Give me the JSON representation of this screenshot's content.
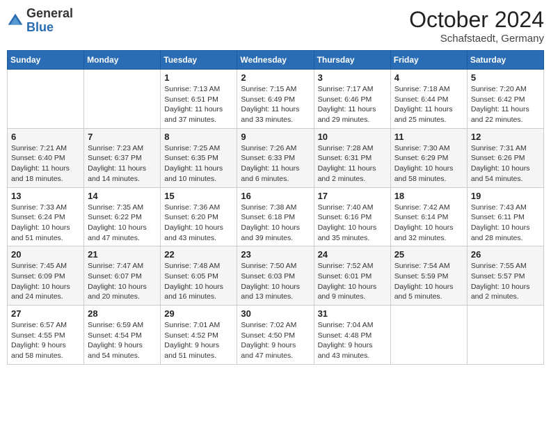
{
  "header": {
    "logo_general": "General",
    "logo_blue": "Blue",
    "month_title": "October 2024",
    "location": "Schafstaedt, Germany"
  },
  "days_of_week": [
    "Sunday",
    "Monday",
    "Tuesday",
    "Wednesday",
    "Thursday",
    "Friday",
    "Saturday"
  ],
  "weeks": [
    [
      {
        "day": "",
        "info": ""
      },
      {
        "day": "",
        "info": ""
      },
      {
        "day": "1",
        "info": "Sunrise: 7:13 AM\nSunset: 6:51 PM\nDaylight: 11 hours\nand 37 minutes."
      },
      {
        "day": "2",
        "info": "Sunrise: 7:15 AM\nSunset: 6:49 PM\nDaylight: 11 hours\nand 33 minutes."
      },
      {
        "day": "3",
        "info": "Sunrise: 7:17 AM\nSunset: 6:46 PM\nDaylight: 11 hours\nand 29 minutes."
      },
      {
        "day": "4",
        "info": "Sunrise: 7:18 AM\nSunset: 6:44 PM\nDaylight: 11 hours\nand 25 minutes."
      },
      {
        "day": "5",
        "info": "Sunrise: 7:20 AM\nSunset: 6:42 PM\nDaylight: 11 hours\nand 22 minutes."
      }
    ],
    [
      {
        "day": "6",
        "info": "Sunrise: 7:21 AM\nSunset: 6:40 PM\nDaylight: 11 hours\nand 18 minutes."
      },
      {
        "day": "7",
        "info": "Sunrise: 7:23 AM\nSunset: 6:37 PM\nDaylight: 11 hours\nand 14 minutes."
      },
      {
        "day": "8",
        "info": "Sunrise: 7:25 AM\nSunset: 6:35 PM\nDaylight: 11 hours\nand 10 minutes."
      },
      {
        "day": "9",
        "info": "Sunrise: 7:26 AM\nSunset: 6:33 PM\nDaylight: 11 hours\nand 6 minutes."
      },
      {
        "day": "10",
        "info": "Sunrise: 7:28 AM\nSunset: 6:31 PM\nDaylight: 11 hours\nand 2 minutes."
      },
      {
        "day": "11",
        "info": "Sunrise: 7:30 AM\nSunset: 6:29 PM\nDaylight: 10 hours\nand 58 minutes."
      },
      {
        "day": "12",
        "info": "Sunrise: 7:31 AM\nSunset: 6:26 PM\nDaylight: 10 hours\nand 54 minutes."
      }
    ],
    [
      {
        "day": "13",
        "info": "Sunrise: 7:33 AM\nSunset: 6:24 PM\nDaylight: 10 hours\nand 51 minutes."
      },
      {
        "day": "14",
        "info": "Sunrise: 7:35 AM\nSunset: 6:22 PM\nDaylight: 10 hours\nand 47 minutes."
      },
      {
        "day": "15",
        "info": "Sunrise: 7:36 AM\nSunset: 6:20 PM\nDaylight: 10 hours\nand 43 minutes."
      },
      {
        "day": "16",
        "info": "Sunrise: 7:38 AM\nSunset: 6:18 PM\nDaylight: 10 hours\nand 39 minutes."
      },
      {
        "day": "17",
        "info": "Sunrise: 7:40 AM\nSunset: 6:16 PM\nDaylight: 10 hours\nand 35 minutes."
      },
      {
        "day": "18",
        "info": "Sunrise: 7:42 AM\nSunset: 6:14 PM\nDaylight: 10 hours\nand 32 minutes."
      },
      {
        "day": "19",
        "info": "Sunrise: 7:43 AM\nSunset: 6:11 PM\nDaylight: 10 hours\nand 28 minutes."
      }
    ],
    [
      {
        "day": "20",
        "info": "Sunrise: 7:45 AM\nSunset: 6:09 PM\nDaylight: 10 hours\nand 24 minutes."
      },
      {
        "day": "21",
        "info": "Sunrise: 7:47 AM\nSunset: 6:07 PM\nDaylight: 10 hours\nand 20 minutes."
      },
      {
        "day": "22",
        "info": "Sunrise: 7:48 AM\nSunset: 6:05 PM\nDaylight: 10 hours\nand 16 minutes."
      },
      {
        "day": "23",
        "info": "Sunrise: 7:50 AM\nSunset: 6:03 PM\nDaylight: 10 hours\nand 13 minutes."
      },
      {
        "day": "24",
        "info": "Sunrise: 7:52 AM\nSunset: 6:01 PM\nDaylight: 10 hours\nand 9 minutes."
      },
      {
        "day": "25",
        "info": "Sunrise: 7:54 AM\nSunset: 5:59 PM\nDaylight: 10 hours\nand 5 minutes."
      },
      {
        "day": "26",
        "info": "Sunrise: 7:55 AM\nSunset: 5:57 PM\nDaylight: 10 hours\nand 2 minutes."
      }
    ],
    [
      {
        "day": "27",
        "info": "Sunrise: 6:57 AM\nSunset: 4:55 PM\nDaylight: 9 hours\nand 58 minutes."
      },
      {
        "day": "28",
        "info": "Sunrise: 6:59 AM\nSunset: 4:54 PM\nDaylight: 9 hours\nand 54 minutes."
      },
      {
        "day": "29",
        "info": "Sunrise: 7:01 AM\nSunset: 4:52 PM\nDaylight: 9 hours\nand 51 minutes."
      },
      {
        "day": "30",
        "info": "Sunrise: 7:02 AM\nSunset: 4:50 PM\nDaylight: 9 hours\nand 47 minutes."
      },
      {
        "day": "31",
        "info": "Sunrise: 7:04 AM\nSunset: 4:48 PM\nDaylight: 9 hours\nand 43 minutes."
      },
      {
        "day": "",
        "info": ""
      },
      {
        "day": "",
        "info": ""
      }
    ]
  ]
}
